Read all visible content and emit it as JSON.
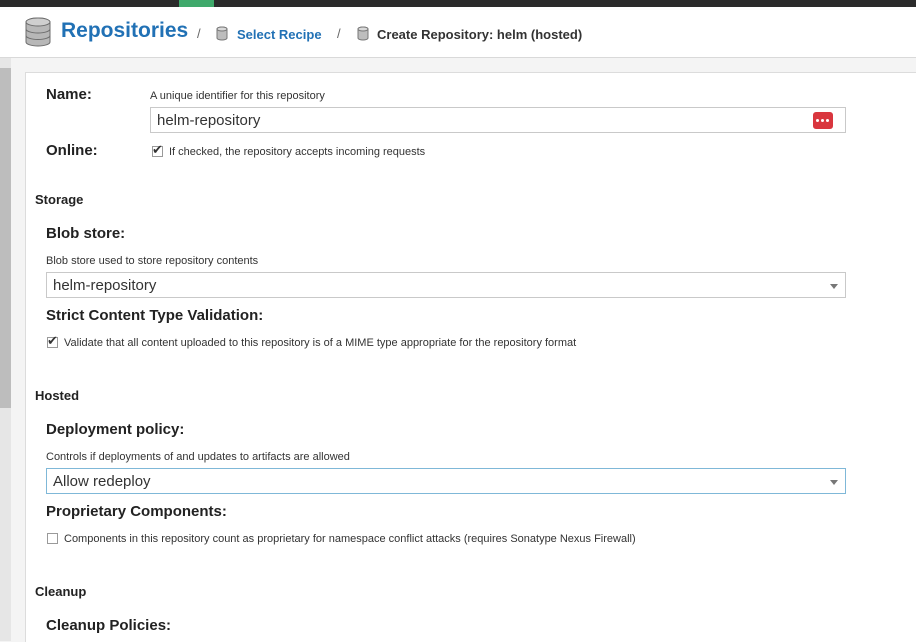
{
  "header": {
    "title": "Repositories",
    "breadcrumb_sep": "/",
    "select_recipe": "Select Recipe",
    "current": "Create Repository: helm (hosted)"
  },
  "form": {
    "name_label": "Name:",
    "name_help": "A unique identifier for this repository",
    "name_value": "helm-repository",
    "online_label": "Online:",
    "online_checked": true,
    "online_text": "If checked, the repository accepts incoming requests",
    "storage_section": "Storage",
    "blob_label": "Blob store:",
    "blob_help": "Blob store used to store repository contents",
    "blob_value": "helm-repository",
    "strict_label": "Strict Content Type Validation:",
    "strict_checked": true,
    "strict_text": "Validate that all content uploaded to this repository is of a MIME type appropriate for the repository format",
    "hosted_section": "Hosted",
    "deploy_label": "Deployment policy:",
    "deploy_help": "Controls if deployments of and updates to artifacts are allowed",
    "deploy_value": "Allow redeploy",
    "proprietary_label": "Proprietary Components:",
    "proprietary_checked": false,
    "proprietary_text": "Components in this repository count as proprietary for namespace conflict attacks (requires Sonatype Nexus Firewall)",
    "cleanup_section": "Cleanup",
    "cleanup_label": "Cleanup Policies:"
  },
  "colors": {
    "accent": "#2171b5",
    "tab_indicator": "#3fa96b",
    "password_manager": "#d9363e"
  },
  "icons": {
    "repo": "database-icon",
    "crumb": "database-icon",
    "password_manager": "dots-icon"
  }
}
